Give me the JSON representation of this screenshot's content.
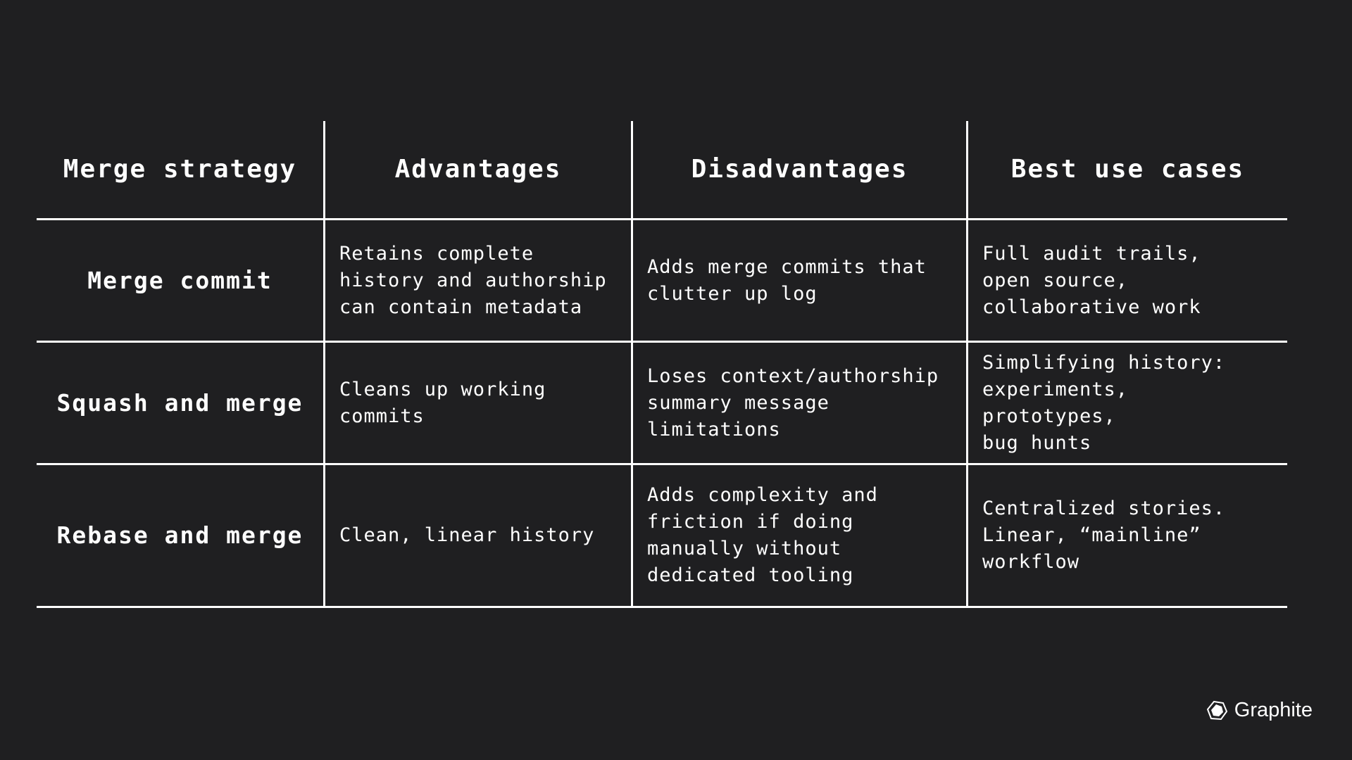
{
  "table": {
    "headers": [
      "Merge strategy",
      "Advantages",
      "Disadvantages",
      "Best use cases"
    ],
    "rows": [
      {
        "strategy": "Merge commit",
        "advantages": "Retains complete\nhistory and authorship\ncan contain metadata",
        "disadvantages": "Adds merge commits that\nclutter up log",
        "use_cases": "Full audit trails,\nopen source,\ncollaborative work"
      },
      {
        "strategy": "Squash and merge",
        "advantages": "Cleans up working\ncommits",
        "disadvantages": "Loses context/authorship\nsummary message\nlimitations",
        "use_cases": "Simplifying history:\nexperiments, prototypes,\nbug hunts"
      },
      {
        "strategy": "Rebase and merge",
        "advantages": "Clean, linear history",
        "disadvantages": "Adds complexity and\nfriction if doing\nmanually without\ndedicated tooling",
        "use_cases": "Centralized stories.\nLinear, “mainline”\nworkflow"
      }
    ]
  },
  "branding": {
    "logo_icon": "hexagon-logo-icon",
    "name": "Graphite"
  },
  "colors": {
    "background": "#1f1f21",
    "foreground": "#ffffff"
  }
}
